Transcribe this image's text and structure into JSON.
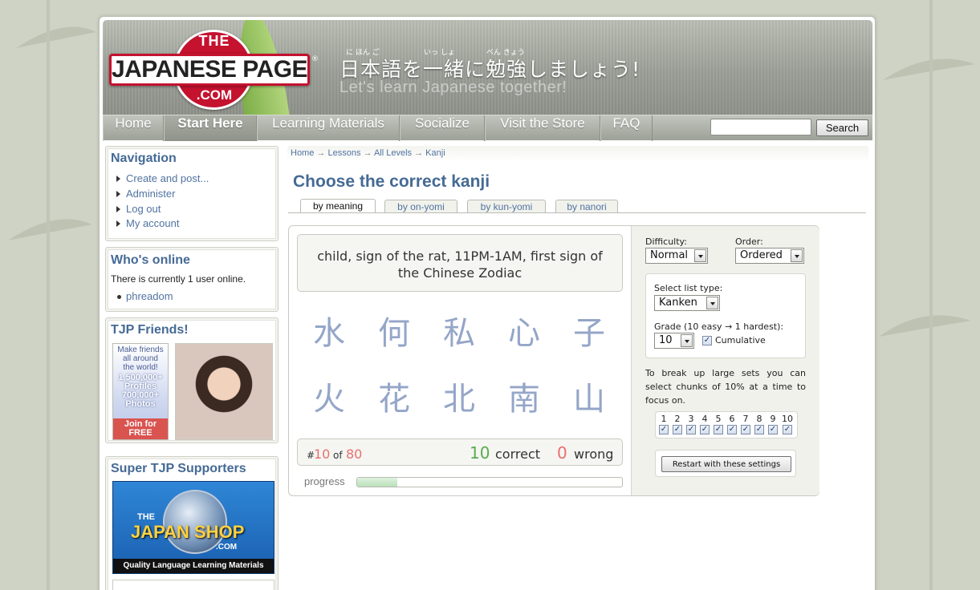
{
  "header": {
    "logo": {
      "the": "THE",
      "main": "JAPANESE PAGE",
      "com": ".COM",
      "reg": "®"
    },
    "tagline_jp": "日本語を一緒に勉強しましょう!",
    "furigana": [
      "に ほん ご",
      "いっ しょ",
      "べん きょう"
    ],
    "tagline_en": "Let's learn Japanese together!"
  },
  "nav": {
    "items": [
      "Home",
      "Start Here",
      "Learning Materials",
      "Socialize",
      "Visit the Store",
      "FAQ"
    ],
    "active": "Start Here",
    "search_button": "Search",
    "search_value": ""
  },
  "sidebar": {
    "navigation": {
      "title": "Navigation",
      "links": [
        "Create and post...",
        "Administer",
        "Log out",
        "My account"
      ]
    },
    "whos_online": {
      "title": "Who's online",
      "text": "There is currently 1 user online.",
      "users": [
        "phreadom"
      ]
    },
    "friends": {
      "title": "TJP Friends!",
      "ad_lines": [
        "Make friends",
        "all around",
        "the world!",
        "1,500,000+",
        "Profiles",
        "700,000+",
        "Photos",
        "Join for",
        "FREE"
      ]
    },
    "supporters": {
      "title": "Super TJP Supporters",
      "shop_the": "THE",
      "shop_name": "JAPAN SHOP",
      "shop_com": ".COM",
      "shop_tagline": "Quality Language Learning Materials"
    }
  },
  "breadcrumb": [
    "Home",
    "Lessons",
    "All Levels",
    "Kanji"
  ],
  "breadcrumb_sep": "→",
  "page_title": "Choose the correct kanji",
  "tabs": [
    "by meaning",
    "by on-yomi",
    "by kun-yomi",
    "by nanori"
  ],
  "active_tab": "by meaning",
  "quiz": {
    "question": "child, sign of the rat, 11PM-1AM, first sign of the Chinese Zodiac",
    "choices": [
      "水",
      "何",
      "私",
      "心",
      "子",
      "火",
      "花",
      "北",
      "南",
      "山"
    ],
    "hash": "#",
    "current": "10",
    "of": "of",
    "total": "80",
    "correct_count": "10",
    "correct_label": "correct",
    "wrong_count": "0",
    "wrong_label": "wrong",
    "progress_label": "progress",
    "progress_fraction": 0.15
  },
  "settings": {
    "difficulty_label": "Difficulty:",
    "difficulty_value": "Normal",
    "order_label": "Order:",
    "order_value": "Ordered",
    "list_type_label": "Select list type:",
    "list_type_value": "Kanken",
    "grade_label": "Grade (10 easy → 1 hardest):",
    "grade_value": "10",
    "cumulative_label": "Cumulative",
    "cumulative_checked": true,
    "chunks_text": "To break up large sets you can select chunks of 10% at a time to focus on.",
    "chunks": [
      "1",
      "2",
      "3",
      "4",
      "5",
      "6",
      "7",
      "8",
      "9",
      "10"
    ],
    "restart_label": "Restart with these settings"
  },
  "colors": {
    "accent": "#456a95",
    "correct": "#5aab50",
    "wrong": "#e8706e",
    "kanji": "#94a6c8"
  }
}
